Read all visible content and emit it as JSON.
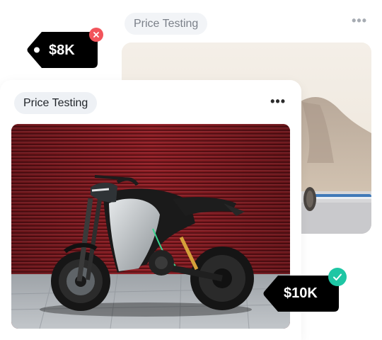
{
  "cards": {
    "back": {
      "tag_label": "Price Testing",
      "menu_icon": "more-horizontal-icon"
    },
    "front": {
      "tag_label": "Price Testing",
      "menu_icon": "more-horizontal-icon"
    }
  },
  "prices": {
    "rejected": {
      "label": "$8K",
      "status_icon": "close-icon",
      "status_color": "#f2545b"
    },
    "accepted": {
      "label": "$10K",
      "status_icon": "check-icon",
      "status_color": "#1ec6a4"
    }
  },
  "colors": {
    "tag_background": "#000000",
    "pill_background": "#eef1f5",
    "shutter_red": "#8c1e23"
  }
}
